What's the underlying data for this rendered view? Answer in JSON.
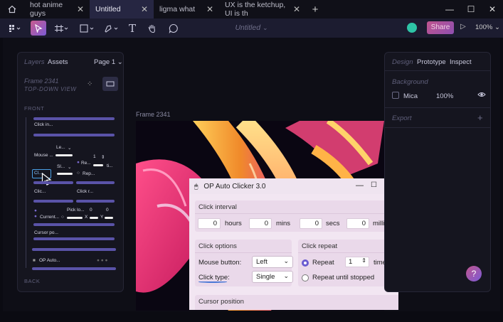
{
  "tabs": [
    {
      "label": "hot anime guys",
      "active": false
    },
    {
      "label": "Untitled",
      "active": true
    },
    {
      "label": "ligma what",
      "active": false
    },
    {
      "label": "UX is the ketchup, UI is th",
      "active": false
    }
  ],
  "toolbar": {
    "doc_title": "Untitled",
    "share_label": "Share",
    "zoom": "100%"
  },
  "layers_panel": {
    "tab_layers": "Layers",
    "tab_assets": "Assets",
    "page": "Page 1",
    "frame_name": "Frame 2341",
    "frame_sub": "TOP-DOWN VIEW",
    "section_front": "FRONT",
    "section_back": "BACK",
    "mini": {
      "click_in": "Click in...",
      "mouse": "Mouse ...",
      "le": "Le...",
      "one": "1",
      "re": "Re...",
      "ti": "ti...",
      "sl": "Sl...",
      "rep": "Rep...",
      "cl": "Cl...",
      "clic": "Clic...",
      "click_r": "Click r...",
      "pick_lo": "Pick lo...",
      "zero_a": "0",
      "zero_b": "0",
      "current": "Current...",
      "x": "X",
      "y": "Y",
      "cursor_po": "Cursor po...",
      "op_auto": "OP Auto..."
    }
  },
  "canvas": {
    "frame_label": "Frame 2341"
  },
  "app": {
    "title": "OP Auto Clicker 3.0",
    "click_interval": {
      "heading": "Click interval",
      "hours_value": "0",
      "hours_label": "hours",
      "mins_value": "0",
      "mins_label": "mins",
      "secs_value": "0",
      "secs_label": "secs",
      "milli_value": "0",
      "milli_label": "milli"
    },
    "click_options": {
      "heading": "Click options",
      "mouse_button_label": "Mouse button:",
      "mouse_button_value": "Left",
      "click_type_label": "Click type:",
      "click_type_value": "Single"
    },
    "click_repeat": {
      "heading": "Click repeat",
      "repeat_label": "Repeat",
      "repeat_value": "1",
      "times_label": "time",
      "until_stopped_label": "Repeat until stopped"
    },
    "cursor_position": {
      "heading": "Cursor position"
    }
  },
  "design_panel": {
    "tab_design": "Design",
    "tab_prototype": "Prototype",
    "tab_inspect": "Inspect",
    "background_heading": "Background",
    "fill_name": "Mica",
    "fill_opacity": "100%",
    "export_heading": "Export"
  },
  "help_label": "?",
  "colors": {
    "accent": "#6a5bd0",
    "share": "#c0558e",
    "avatar": "#2ec4a6"
  }
}
